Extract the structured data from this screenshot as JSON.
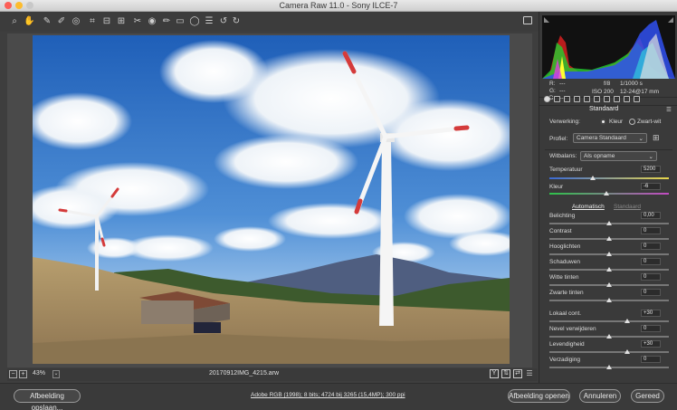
{
  "window": {
    "title": "Camera Raw 11.0  -  Sony ILCE-7"
  },
  "toolbar": {
    "icons": [
      "zoom-icon",
      "hand-icon",
      "white-balance-icon",
      "color-sampler-icon",
      "target-adjust-icon",
      "crop-icon",
      "straighten-icon",
      "transform-icon",
      "spot-removal-icon",
      "red-eye-icon",
      "adjustment-brush-icon",
      "graduated-filter-icon",
      "radial-filter-icon",
      "preferences-icon",
      "rotate-ccw-icon",
      "rotate-cw-icon"
    ]
  },
  "histogram": {
    "r_label": "R:",
    "g_label": "G:",
    "b_label": "B:",
    "r_value": "---",
    "g_value": "---",
    "b_value": "---",
    "aperture": "f/8",
    "shutter": "1/1000 s",
    "iso": "ISO 200",
    "lens": "12-24@17 mm"
  },
  "panel": {
    "section_title": "Standaard",
    "treatment_label": "Verwerking:",
    "treatment_options": [
      "Kleur",
      "Zwart-wit"
    ],
    "profile_label": "Profiel:",
    "profile_value": "Camera Standaard",
    "wb_label": "Witbalans:",
    "wb_value": "Als opname",
    "temperature_label": "Temperatuur",
    "temperature_value": "5200",
    "tint_label": "Kleur",
    "tint_value": "-6",
    "auto_label": "Automatisch",
    "default_label": "Standaard",
    "sliders": [
      {
        "label": "Belichting",
        "value": "0,00",
        "pos": 0.5
      },
      {
        "label": "Contrast",
        "value": "0",
        "pos": 0.5
      },
      {
        "label": "Hooglichten",
        "value": "0",
        "pos": 0.5
      },
      {
        "label": "Schaduwen",
        "value": "0",
        "pos": 0.5
      },
      {
        "label": "Witte tinten",
        "value": "0",
        "pos": 0.5
      },
      {
        "label": "Zwarte tinten",
        "value": "0",
        "pos": 0.5
      }
    ],
    "sliders2": [
      {
        "label": "Lokaal cont.",
        "value": "+30",
        "pos": 0.65
      },
      {
        "label": "Nevel verwijderen",
        "value": "0",
        "pos": 0.5
      },
      {
        "label": "Levendigheid",
        "value": "+30",
        "pos": 0.65
      },
      {
        "label": "Verzadiging",
        "value": "0",
        "pos": 0.5
      }
    ],
    "temperature_pos": 0.36,
    "tint_pos": 0.48
  },
  "status": {
    "zoom": "43%",
    "filename": "20170912IMG_4215.arw"
  },
  "footer": {
    "save_label": "Afbeelding opslaan...",
    "workflow_link": "Adobe RGB (1998); 8 bits; 4724 bij 3265 (15,4MP); 300 ppi",
    "open_label": "Afbeelding openen",
    "cancel_label": "Annuleren",
    "done_label": "Gereed"
  }
}
